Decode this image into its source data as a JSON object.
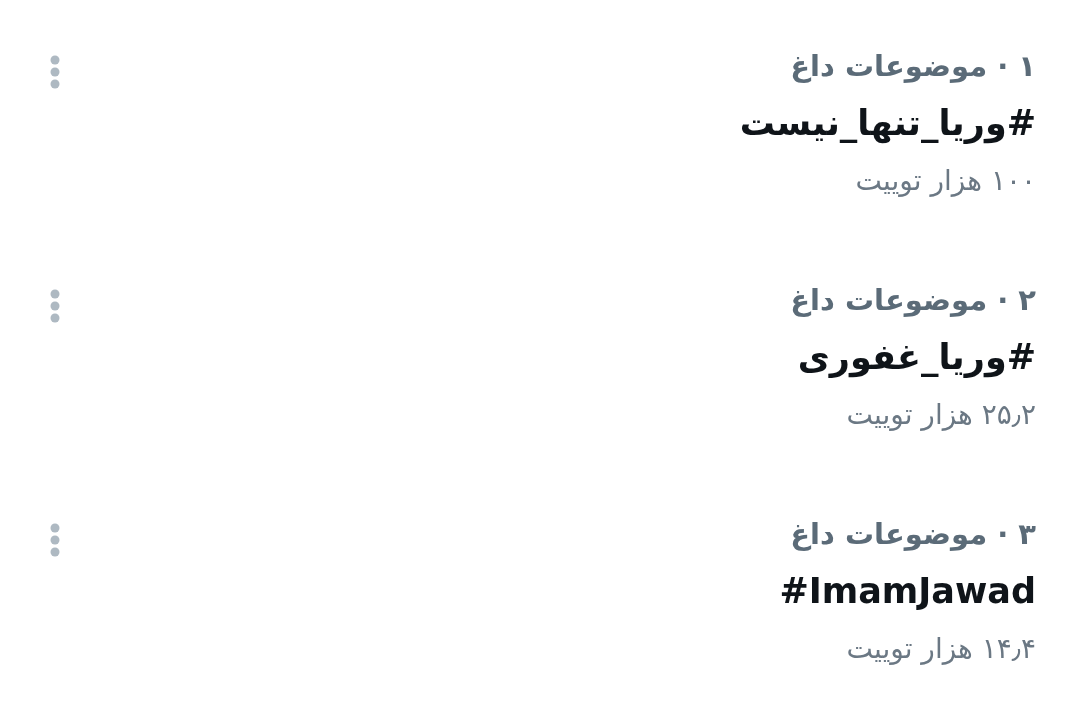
{
  "trends": [
    {
      "context": "۱ · موضوعات داغ",
      "hashtag": "#وریا_تنها_نیست",
      "count": "۱۰۰ هزار توییت"
    },
    {
      "context": "۲ · موضوعات داغ",
      "hashtag": "#وریا_غفوری",
      "count": "۲۵٫۲ هزار توییت"
    },
    {
      "context": "۳ · موضوعات داغ",
      "hashtag": "#ImamJawad",
      "count": "۱۴٫۴ هزار توییت"
    }
  ]
}
